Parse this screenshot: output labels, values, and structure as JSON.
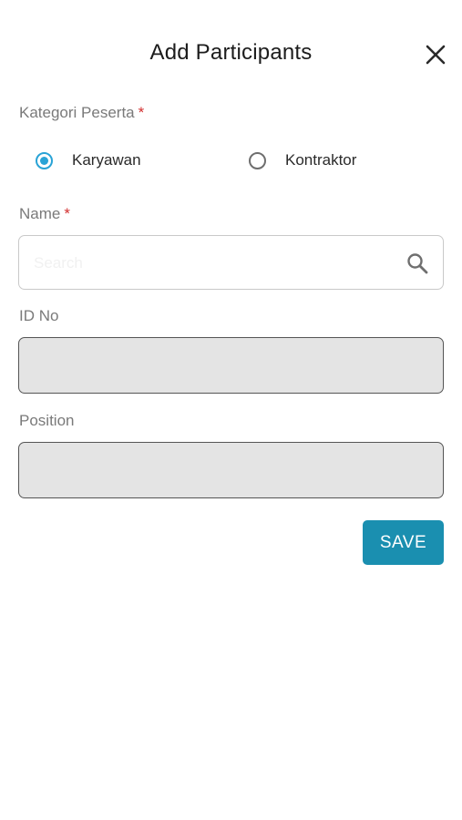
{
  "header": {
    "title": "Add Participants",
    "close_icon": "close-icon"
  },
  "form": {
    "category": {
      "label": "Kategori Peserta",
      "required_mark": "*",
      "options": [
        {
          "label": "Karyawan",
          "selected": true
        },
        {
          "label": "Kontraktor",
          "selected": false
        }
      ]
    },
    "name": {
      "label": "Name",
      "required_mark": "*",
      "placeholder": "Search",
      "value": "",
      "icon": "search-icon"
    },
    "id_no": {
      "label": "ID No",
      "value": ""
    },
    "position": {
      "label": "Position",
      "value": ""
    }
  },
  "actions": {
    "save_label": "SAVE"
  },
  "colors": {
    "accent": "#29a3d6",
    "save_button": "#1a8fb0",
    "required": "#d32f2f",
    "disabled_field": "#e4e4e4"
  }
}
